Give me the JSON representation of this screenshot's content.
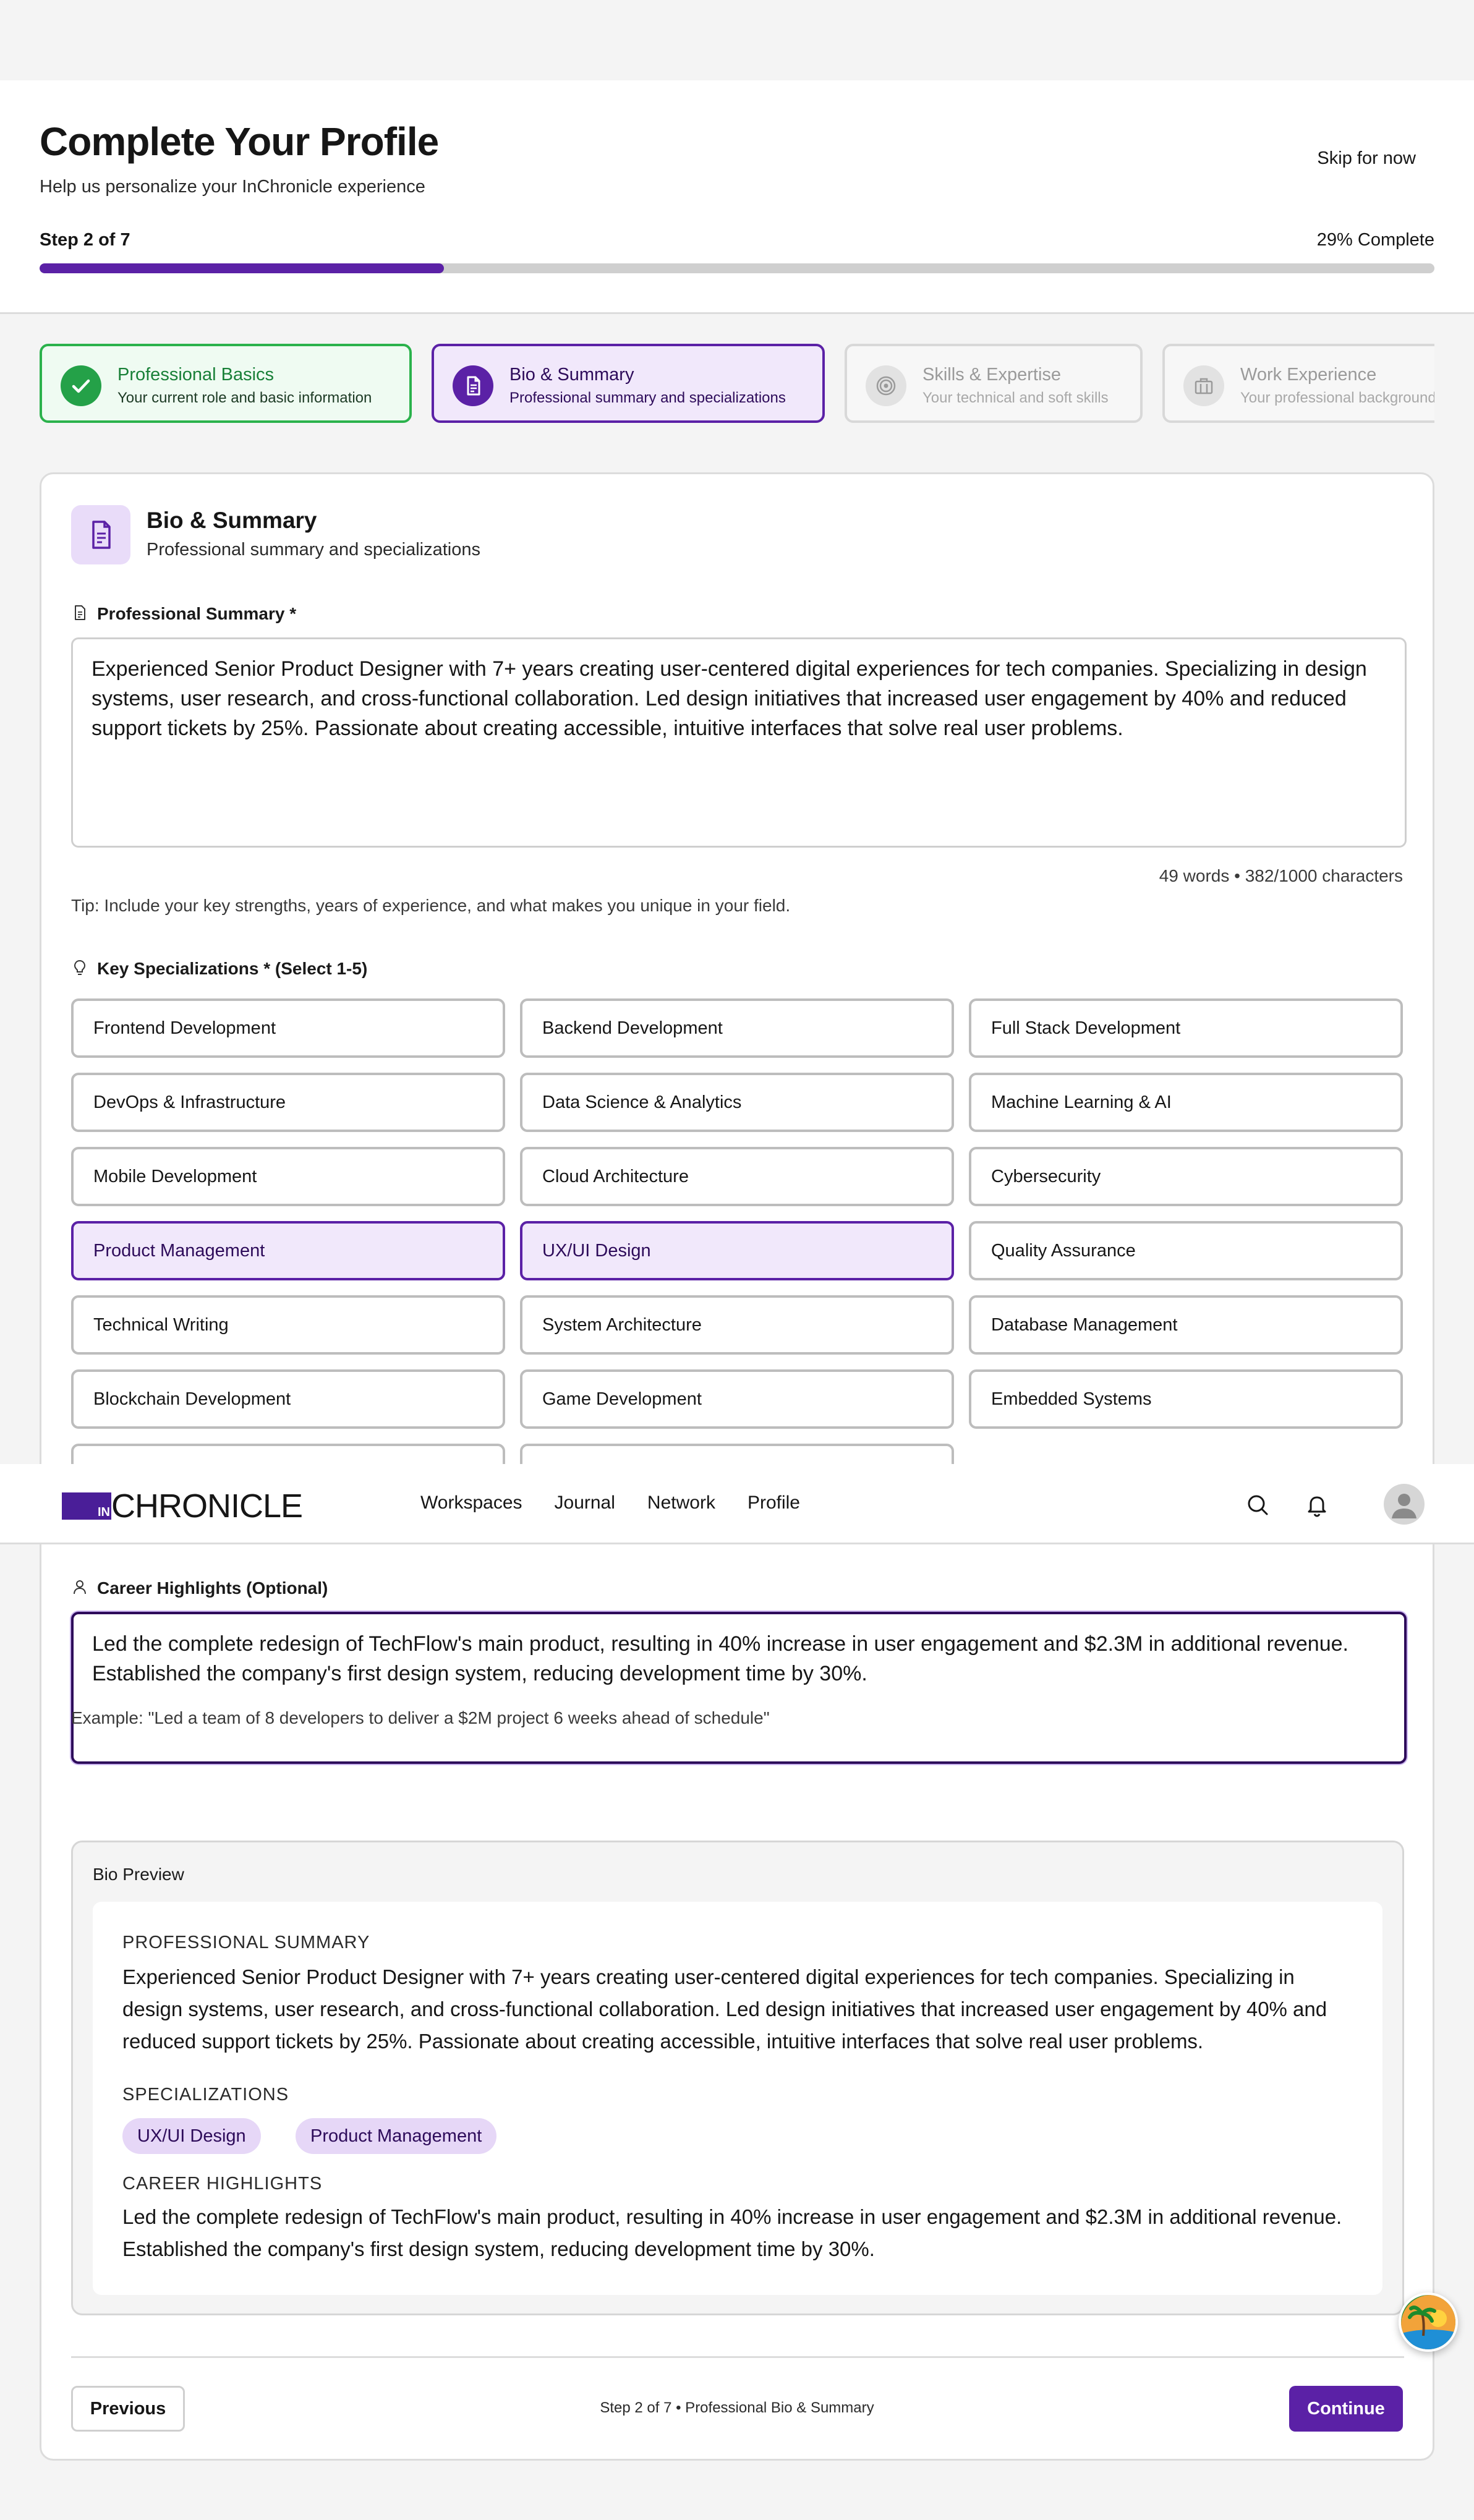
{
  "header": {
    "title": "Complete Your Profile",
    "subtitle": "Help us personalize your InChronicle experience",
    "skip_label": "Skip for now",
    "step_label": "Step 2 of 7",
    "progress_label": "29% Complete",
    "progress_value": 29
  },
  "steps": [
    {
      "title": "Professional Basics",
      "desc": "Your current role and basic information",
      "state": "complete"
    },
    {
      "title": "Bio & Summary",
      "desc": "Professional summary and specializations",
      "state": "active"
    },
    {
      "title": "Skills & Expertise",
      "desc": "Your technical and soft skills",
      "state": "upcoming"
    },
    {
      "title": "Work Experience",
      "desc": "Your professional background",
      "state": "upcoming"
    }
  ],
  "section": {
    "title": "Bio & Summary",
    "subtitle": "Professional summary and specializations"
  },
  "summary": {
    "label": "Professional Summary *",
    "value": "Experienced Senior Product Designer with 7+ years creating user-centered digital experiences for tech companies. Specializing in design systems, user research, and cross-functional collaboration. Led design initiatives that increased user engagement by 40% and reduced support tickets by 25%. Passionate about creating accessible, intuitive interfaces that solve real user problems.",
    "counter": "49 words • 382/1000 characters",
    "tip": "Tip: Include your key strengths, years of experience, and what makes you unique in your field."
  },
  "specializations": {
    "label": "Key Specializations * (Select 1-5)",
    "items": [
      {
        "label": "Frontend Development",
        "selected": false
      },
      {
        "label": "Backend Development",
        "selected": false
      },
      {
        "label": "Full Stack Development",
        "selected": false
      },
      {
        "label": "DevOps & Infrastructure",
        "selected": false
      },
      {
        "label": "Data Science & Analytics",
        "selected": false
      },
      {
        "label": "Machine Learning & AI",
        "selected": false
      },
      {
        "label": "Mobile Development",
        "selected": false
      },
      {
        "label": "Cloud Architecture",
        "selected": false
      },
      {
        "label": "Cybersecurity",
        "selected": false
      },
      {
        "label": "Product Management",
        "selected": true
      },
      {
        "label": "UX/UI Design",
        "selected": true
      },
      {
        "label": "Quality Assurance",
        "selected": false
      },
      {
        "label": "Technical Writing",
        "selected": false
      },
      {
        "label": "System Architecture",
        "selected": false
      },
      {
        "label": "Database Management",
        "selected": false
      },
      {
        "label": "Blockchain Development",
        "selected": false
      },
      {
        "label": "Game Development",
        "selected": false
      },
      {
        "label": "Embedded Systems",
        "selected": false
      }
    ]
  },
  "nav": {
    "logo_mark": "IN",
    "logo_word": "CHRONICLE",
    "links": [
      "Workspaces",
      "Journal",
      "Network",
      "Profile"
    ],
    "search_icon": "search-icon",
    "bell_icon": "bell-icon"
  },
  "highlights": {
    "label": "Career Highlights (Optional)",
    "value": "Led the complete redesign of TechFlow's main product, resulting in 40% increase in user engagement and $2.3M in additional revenue. Established the company's first design system, reducing development time by 30%.",
    "example": "Example: \"Led a team of 8 developers to deliver a $2M project 6 weeks ahead of schedule\""
  },
  "preview": {
    "heading": "Bio Preview",
    "summary_label": "PROFESSIONAL SUMMARY",
    "summary_text": "Experienced Senior Product Designer with 7+ years creating user-centered digital experiences for tech companies. Specializing in design systems, user research, and cross-functional collaboration. Led design initiatives that increased user engagement by 40% and reduced support tickets by 25%. Passionate about creating accessible, intuitive interfaces that solve real user problems.",
    "spec_label": "SPECIALIZATIONS",
    "tags": [
      "UX/UI Design",
      "Product Management"
    ],
    "highlights_label": "CAREER HIGHLIGHTS",
    "highlights_text": "Led the complete redesign of TechFlow's main product, resulting in 40% increase in user engagement and $2.3M in additional revenue. Established the company's first design system, reducing development time by 30%."
  },
  "footer": {
    "previous_label": "Previous",
    "step_text": "Step 2 of 7 • Professional Bio & Summary",
    "continue_label": "Continue"
  },
  "colors": {
    "accent": "#5b21a6",
    "success": "#24a148",
    "selected_bg": "#f1e8fb"
  }
}
